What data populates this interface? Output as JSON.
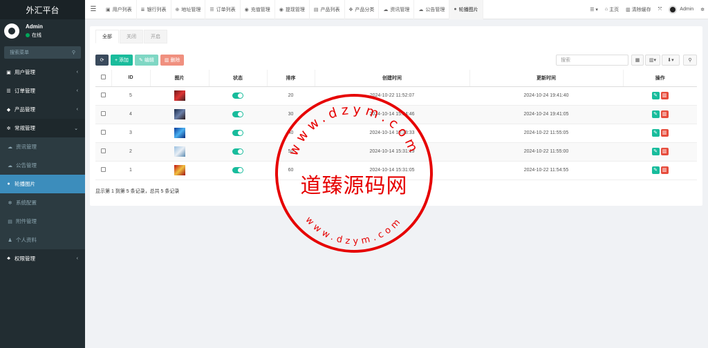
{
  "brand": "外汇平台",
  "user": {
    "name": "Admin",
    "status": "在线"
  },
  "sidebar": {
    "search_placeholder": "搜索菜单",
    "items": [
      {
        "label": "用户管理",
        "icon": "user-icon"
      },
      {
        "label": "订单管理",
        "icon": "list-icon"
      },
      {
        "label": "产品管理",
        "icon": "box-icon"
      },
      {
        "label": "常规管理",
        "icon": "cogs-icon"
      },
      {
        "label": "资讯管理",
        "icon": "cloud-icon"
      },
      {
        "label": "公告管理",
        "icon": "cloud-icon"
      },
      {
        "label": "轮播图片",
        "icon": "circle-icon"
      },
      {
        "label": "系统配置",
        "icon": "cog-icon"
      },
      {
        "label": "附件管理",
        "icon": "file-icon"
      },
      {
        "label": "个人资料",
        "icon": "person-icon"
      },
      {
        "label": "权限管理",
        "icon": "group-icon"
      }
    ]
  },
  "topbar": {
    "tabs": [
      "用户列表",
      "银行列表",
      "地址管理",
      "订单列表",
      "充值管理",
      "提现管理",
      "产品列表",
      "产品分类",
      "资讯管理",
      "公告管理",
      "轮播图片"
    ],
    "home": "主页",
    "clear_cache": "清除缓存",
    "admin": "Admin"
  },
  "subtabs": [
    "全部",
    "关闭",
    "开启"
  ],
  "toolbar": {
    "add": "添加",
    "edit": "编辑",
    "delete": "删除",
    "search_placeholder": "搜索"
  },
  "table": {
    "headers": [
      "ID",
      "图片",
      "状态",
      "排序",
      "创建时间",
      "更新时间",
      "操作"
    ],
    "rows": [
      {
        "id": "5",
        "sort": "20",
        "created": "2024-10-22 11:52:07",
        "updated": "2024-10-24 19:41:40"
      },
      {
        "id": "4",
        "sort": "30",
        "created": "2024-10-14 15:34:46",
        "updated": "2024-10-24 19:41:05"
      },
      {
        "id": "3",
        "sort": "40",
        "created": "2024-10-14 15:33:33",
        "updated": "2024-10-22 11:55:05"
      },
      {
        "id": "2",
        "sort": "50",
        "created": "2024-10-14 15:31:19",
        "updated": "2024-10-22 11:55:00"
      },
      {
        "id": "1",
        "sort": "60",
        "created": "2024-10-14 15:31:05",
        "updated": "2024-10-22 11:54:55"
      }
    ]
  },
  "footer": "显示第 1 到第 5 条记录，总共 5 条记录",
  "watermark": {
    "text": "道臻源码网",
    "ring_text": "www.dzym.com"
  }
}
